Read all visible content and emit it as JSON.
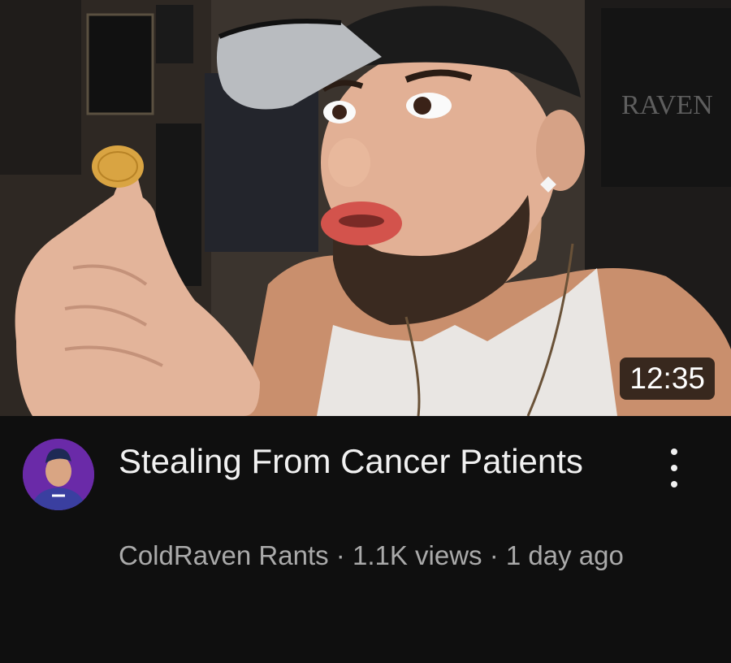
{
  "video": {
    "duration": "12:35",
    "title": "Stealing From Cancer Patients",
    "channel": "ColdRaven Rants",
    "separator": " · ",
    "views": "1.1K views",
    "age": "1 day ago"
  },
  "thumbnail": {
    "poster_text": "RAVEN"
  },
  "icons": {
    "menu": "more-vert-icon"
  },
  "colors": {
    "background": "#0f0f0f",
    "title_text": "#f1f1f1",
    "meta_text": "#aaaaaa",
    "avatar_bg": "#6a2aa8"
  }
}
